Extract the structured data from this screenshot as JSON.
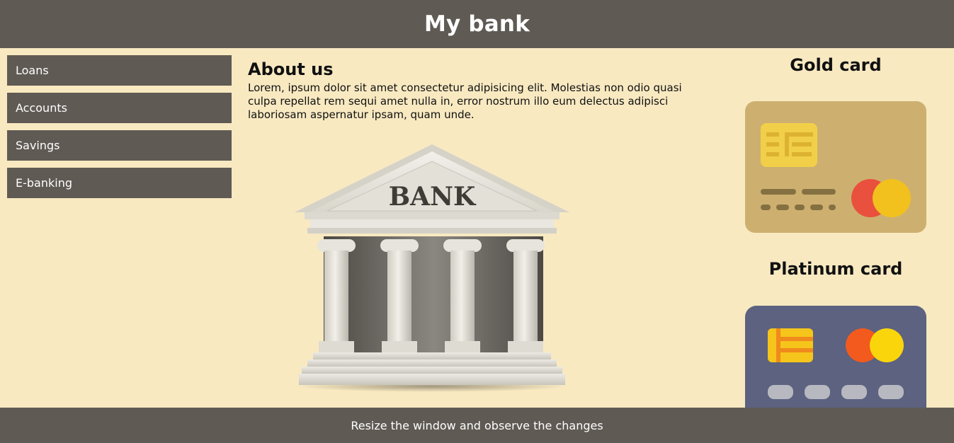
{
  "header": {
    "title": "My bank"
  },
  "sidebar": {
    "items": [
      {
        "label": "Loans"
      },
      {
        "label": "Accounts"
      },
      {
        "label": "Savings"
      },
      {
        "label": "E-banking"
      }
    ]
  },
  "main": {
    "heading": "About us",
    "text": "Lorem, ipsum dolor sit amet consectetur adipisicing elit. Molestias non odio quasi culpa repellat rem sequi amet nulla in, error nostrum illo eum delectus adipisci laboriosam aspernatur ipsam, quam unde.",
    "illustration_label": "BANK"
  },
  "cards": {
    "gold": {
      "title": "Gold card",
      "color": "#cdb070",
      "icon": "credit-card-icon"
    },
    "platinum": {
      "title": "Platinum card",
      "color": "#5c6280",
      "icon": "credit-card-icon"
    }
  },
  "footer": {
    "text": "Resize the window and observe the changes"
  }
}
